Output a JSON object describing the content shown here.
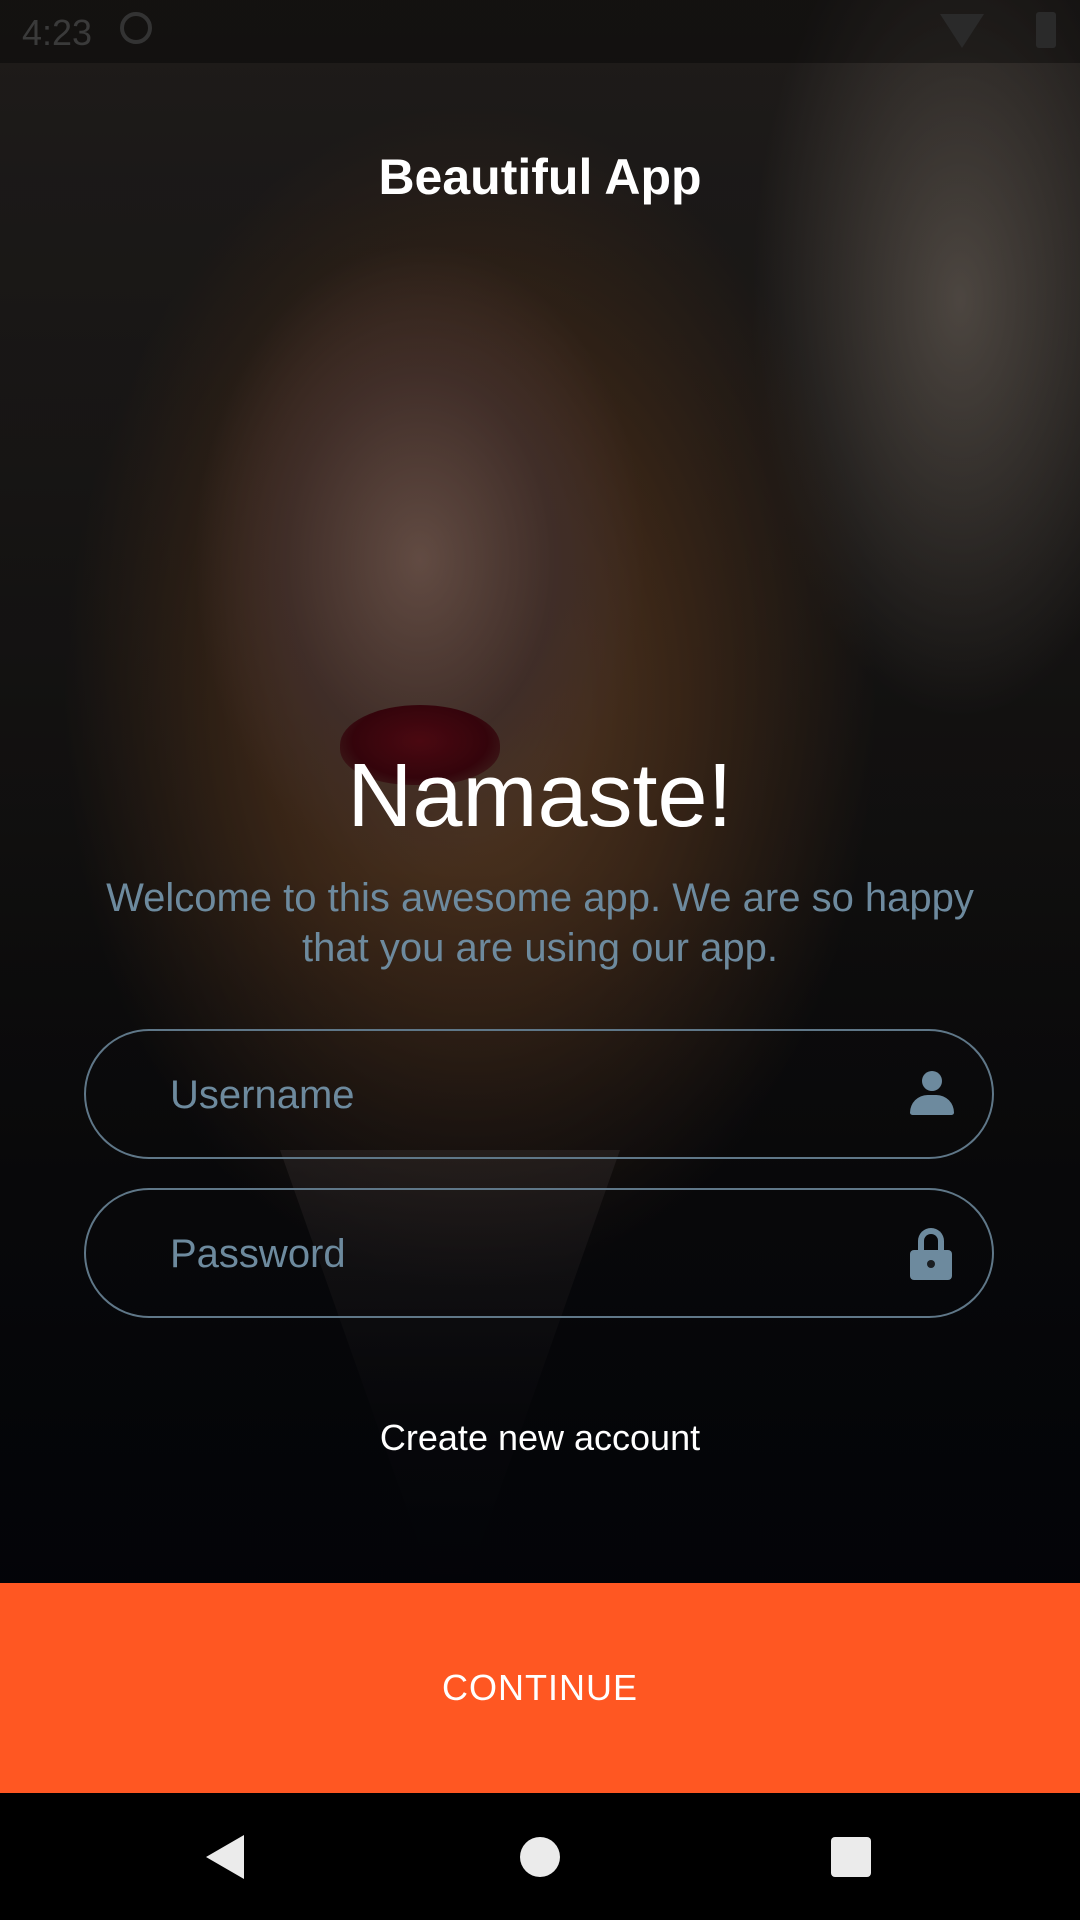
{
  "status_bar": {
    "time": "4:23",
    "icons": [
      "sync-icon",
      "wifi-icon",
      "battery-icon"
    ]
  },
  "app": {
    "title": "Beautiful App"
  },
  "hero": {
    "greeting": "Namaste!",
    "welcome": "Welcome to this awesome app. We are so happy that you are using our app."
  },
  "form": {
    "username": {
      "placeholder": "Username",
      "value": "",
      "icon": "person-icon"
    },
    "password": {
      "placeholder": "Password",
      "value": "",
      "icon": "lock-icon"
    },
    "create_account_label": "Create new account"
  },
  "actions": {
    "continue_label": "CONTINUE"
  },
  "nav_bar": {
    "icons": [
      "back-icon",
      "home-icon",
      "recents-icon"
    ]
  },
  "colors": {
    "accent": "#ff5722",
    "muted_text": "#6d8a9e",
    "field_border": "#5f7788"
  }
}
